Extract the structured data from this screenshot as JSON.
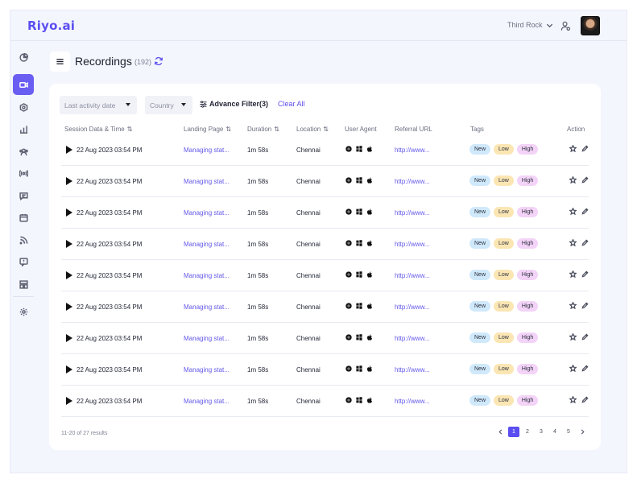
{
  "app": {
    "name": "Riyo.ai"
  },
  "header": {
    "org_name": "Third Rock"
  },
  "sidebar": {
    "items": [
      {
        "icon": "pie-chart-icon"
      },
      {
        "icon": "video-camera-icon",
        "active": true
      },
      {
        "icon": "target-icon"
      },
      {
        "icon": "bar-chart-icon"
      },
      {
        "icon": "users-icon"
      },
      {
        "icon": "broadcast-icon"
      },
      {
        "icon": "chat-icon"
      },
      {
        "icon": "calendar-icon"
      },
      {
        "icon": "rss-icon"
      },
      {
        "icon": "feedback-icon"
      },
      {
        "icon": "layout-icon"
      },
      {
        "icon": "settings-icon"
      }
    ]
  },
  "page": {
    "title": "Recordings",
    "count": "(192)"
  },
  "filters": {
    "last_activity": "Last activity date",
    "country": "Country",
    "advanced": "Advance Filter(3)",
    "clear": "Clear All"
  },
  "table": {
    "columns": [
      "Session Data & Time",
      "Landing Page",
      "Duration",
      "Location",
      "User Agent",
      "Referral URL",
      "Tags",
      "Action"
    ],
    "rows": [
      {
        "session": "22 Aug 2023 03:54 PM",
        "landing": "Managing stat...",
        "duration": "1m 58s",
        "location": "Chennai",
        "referral": "http://www...",
        "tags": [
          "New",
          "Low",
          "High"
        ]
      },
      {
        "session": "22 Aug 2023 03:54 PM",
        "landing": "Managing stat...",
        "duration": "1m 58s",
        "location": "Chennai",
        "referral": "http://www...",
        "tags": [
          "New",
          "Low",
          "High"
        ]
      },
      {
        "session": "22 Aug 2023 03:54 PM",
        "landing": "Managing stat...",
        "duration": "1m 58s",
        "location": "Chennai",
        "referral": "http://www...",
        "tags": [
          "New",
          "Low",
          "High"
        ]
      },
      {
        "session": "22 Aug 2023 03:54 PM",
        "landing": "Managing stat...",
        "duration": "1m 58s",
        "location": "Chennai",
        "referral": "http://www...",
        "tags": [
          "New",
          "Low",
          "High"
        ]
      },
      {
        "session": "22 Aug 2023 03:54 PM",
        "landing": "Managing stat...",
        "duration": "1m 58s",
        "location": "Chennai",
        "referral": "http://www...",
        "tags": [
          "New",
          "Low",
          "High"
        ]
      },
      {
        "session": "22 Aug 2023 03:54 PM",
        "landing": "Managing stat...",
        "duration": "1m 58s",
        "location": "Chennai",
        "referral": "http://www...",
        "tags": [
          "New",
          "Low",
          "High"
        ]
      },
      {
        "session": "22 Aug 2023 03:54 PM",
        "landing": "Managing stat...",
        "duration": "1m 58s",
        "location": "Chennai",
        "referral": "http://www...",
        "tags": [
          "New",
          "Low",
          "High"
        ]
      },
      {
        "session": "22 Aug 2023 03:54 PM",
        "landing": "Managing stat...",
        "duration": "1m 58s",
        "location": "Chennai",
        "referral": "http://www...",
        "tags": [
          "New",
          "Low",
          "High"
        ]
      },
      {
        "session": "22 Aug 2023 03:54 PM",
        "landing": "Managing stat...",
        "duration": "1m 58s",
        "location": "Chennai",
        "referral": "http://www...",
        "tags": [
          "New",
          "Low",
          "High"
        ]
      }
    ]
  },
  "pagination": {
    "summary": "11-20 of 27 results",
    "pages": [
      "1",
      "2",
      "3",
      "4",
      "5"
    ],
    "current": "1"
  },
  "colors": {
    "accent": "#5b4ef0",
    "background": "#f4f6fe"
  }
}
